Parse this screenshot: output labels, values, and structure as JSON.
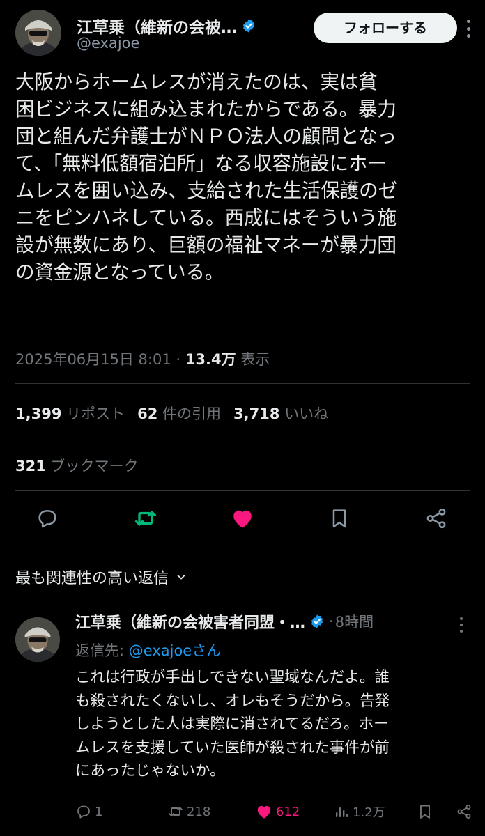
{
  "tweet": {
    "author_name": "江草乗（維新の会被…",
    "handle": "@exajoe",
    "follow_label": "フォローする",
    "text_lines": [
      "大阪からホームレスが消えたのは、実は貧",
      "困ビジネスに組み込まれたからである。暴力",
      "団と組んだ弁護士がＮＰＯ法人の顧問となっ",
      "て、「無料低額宿泊所」なる収容施設にホー",
      "ムレスを囲い込み、支給された生活保護のゼ",
      "ニをピンハネしている。西成にはそういう施",
      "設が無数にあり、巨額の福祉マネーが暴力団",
      "の資金源となっている。"
    ],
    "timestamp": "2025年06月15日 8:01",
    "separator": " · ",
    "views_count": "13.4万",
    "views_label": " 表示"
  },
  "stats": {
    "reposts_count": "1,399",
    "reposts_label": "リポスト",
    "quotes_count": "62",
    "quotes_label": "件の引用",
    "likes_count": "3,718",
    "likes_label": "いいね",
    "bookmarks_count": "321",
    "bookmarks_label": "ブックマーク"
  },
  "colors": {
    "accent": "#1d9bf0",
    "repost_active": "#00ba7c",
    "like_active": "#f91880",
    "muted": "#71767b"
  },
  "actions": {
    "icons": [
      "reply-icon",
      "repost-icon",
      "like-icon",
      "bookmark-icon",
      "share-icon"
    ],
    "reposted": true,
    "liked": true
  },
  "replies_section": {
    "sort_label": "最も関連性の高い返信"
  },
  "reply": {
    "author_name": "江草乗（維新の会被害者同盟・…",
    "time_separator": "·",
    "time": "8時間",
    "reply_to_prefix": "返信先: ",
    "reply_to_handle": "@exajoeさん",
    "text_lines": [
      "これは行政が手出しできない聖域なんだよ。誰",
      "も殺されたくないし、オレもそうだから。告発",
      "しようとした人は実際に消されてるだろ。ホー",
      "ムレスを支援していた医師が殺された事件が前",
      "にあったじゃないか。"
    ],
    "replies": "1",
    "reposts": "218",
    "likes": "612",
    "views": "1.2万"
  }
}
